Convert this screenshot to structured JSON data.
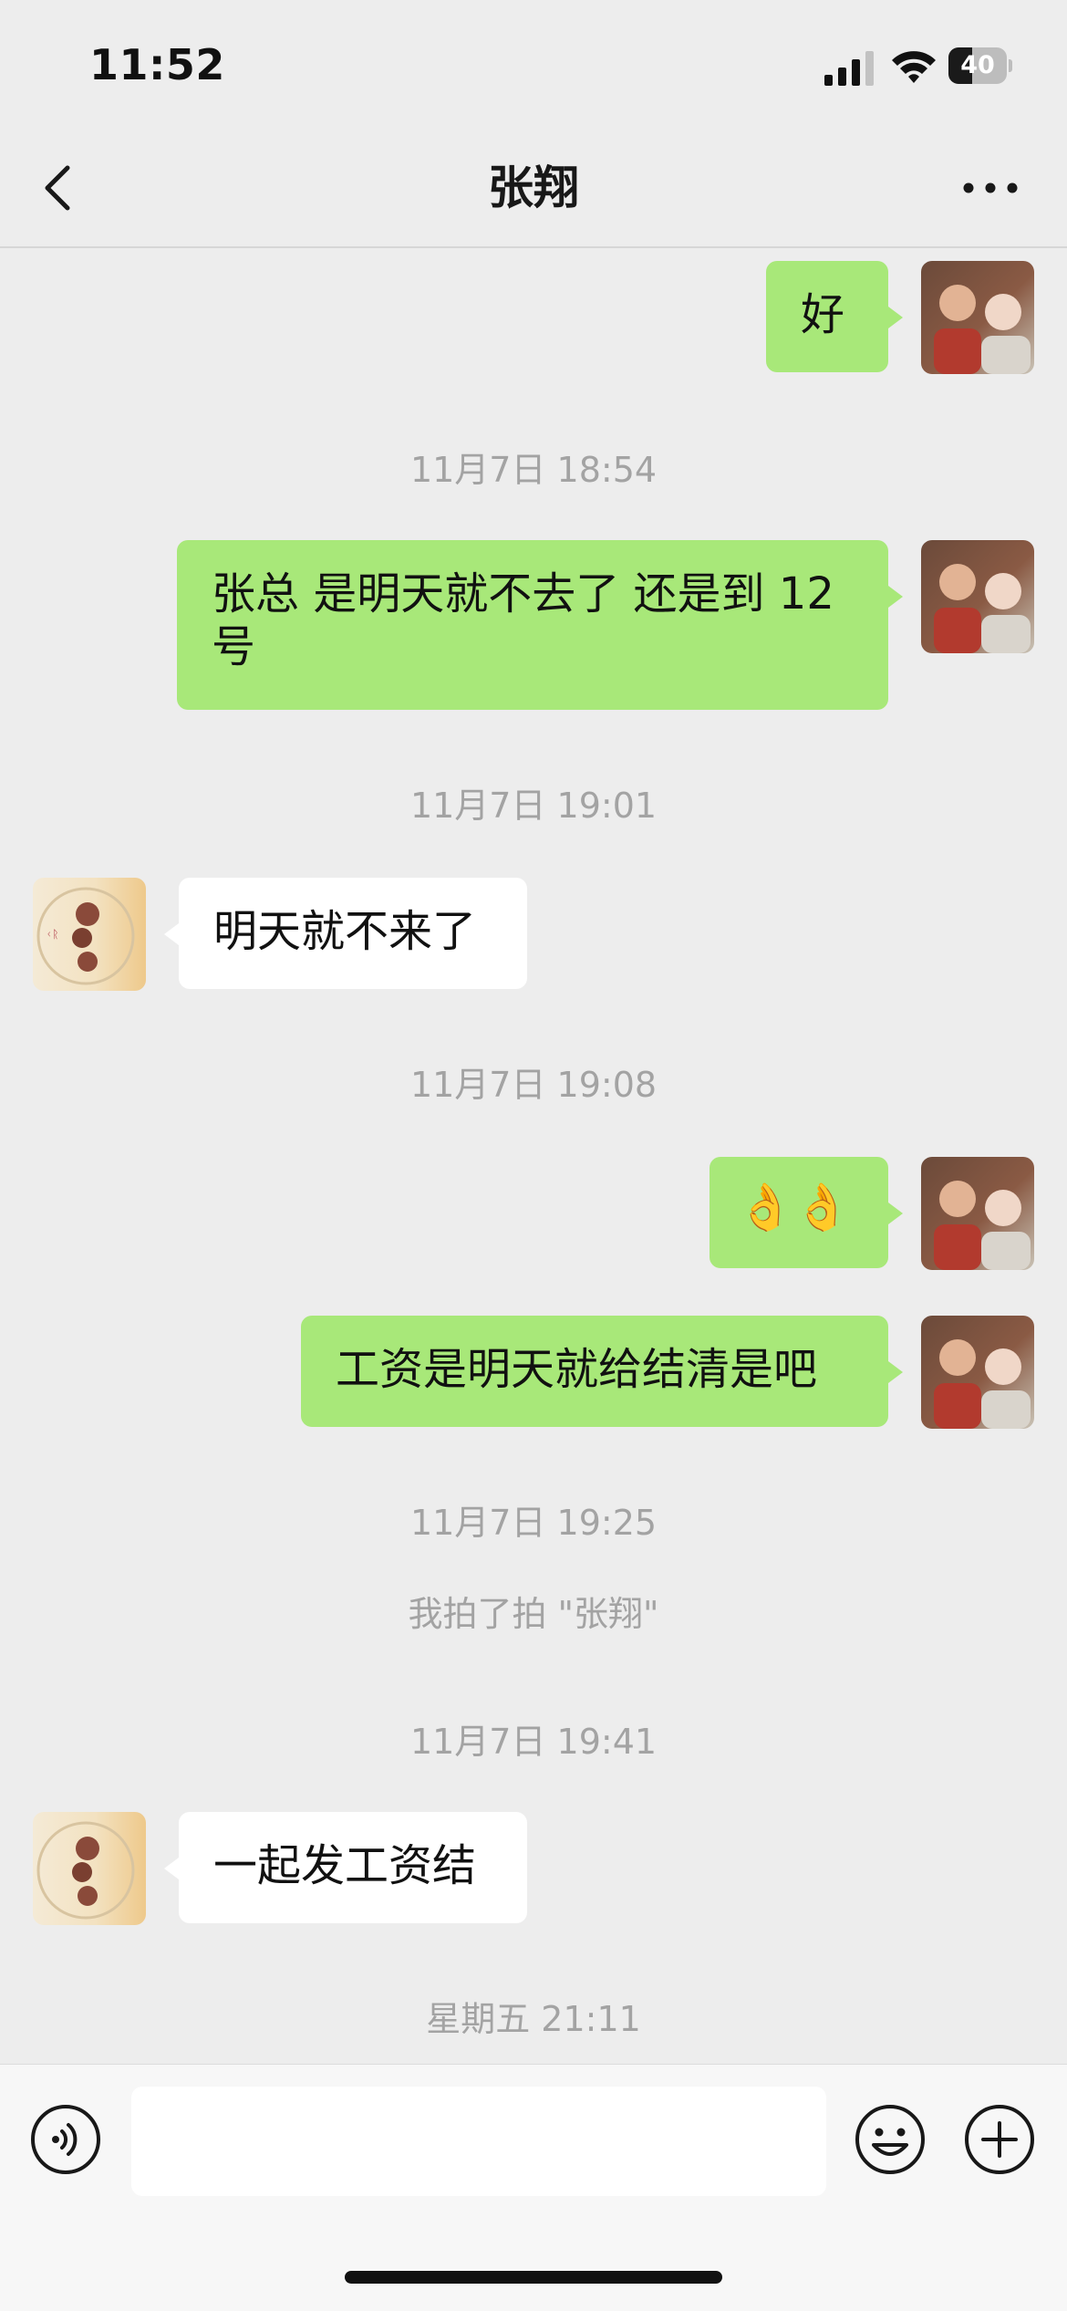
{
  "status_bar": {
    "time": "11:52",
    "battery_level": "40",
    "battery_percent": 40
  },
  "nav": {
    "title": "张翔",
    "back_icon": "chevron-left-icon",
    "more_icon": "more-horizontal-icon"
  },
  "messages": {
    "m1": {
      "text": "好"
    },
    "ts1": "11月7日 18:54",
    "m2": {
      "line1": "张总 是明天就不去了 还是到 12",
      "line2": "号"
    },
    "ts2": "11月7日 19:01",
    "m3": {
      "text": "明天就不来了"
    },
    "ts3": "11月7日 19:08",
    "m4": {
      "emoji": "👌👌"
    },
    "m5": {
      "text": "工资是明天就给结清是吧"
    },
    "ts4": "11月7日 19:25",
    "note": "我拍了拍 \"张翔\"",
    "ts5": "11月7日 19:41",
    "m6": {
      "text": "一起发工资结"
    },
    "ts6": "星期五 21:11"
  },
  "input_bar": {
    "voice_icon": "voice-icon",
    "emoji_icon": "emoji-icon",
    "plus_icon": "plus-icon",
    "placeholder": ""
  },
  "colors": {
    "background": "#ededed",
    "outgoing_bubble": "#a8e879",
    "incoming_bubble": "#ffffff",
    "timestamp_text": "#a3a3a3"
  }
}
